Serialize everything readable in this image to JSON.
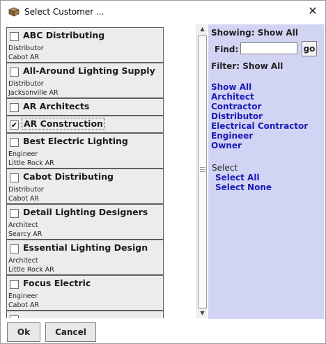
{
  "window": {
    "title": "Select Customer ...",
    "close_glyph": "✕"
  },
  "icons": {
    "app": "box-icon",
    "close": "close-icon"
  },
  "customers": [
    {
      "name": "ABC Distributing",
      "type": "Distributor",
      "location": "Cabot  AR",
      "checked": false
    },
    {
      "name": "All-Around Lighting Supply",
      "type": "Distributor",
      "location": "Jacksonville  AR",
      "checked": false
    },
    {
      "name": "AR Architects",
      "type": "",
      "location": "",
      "checked": false
    },
    {
      "name": "AR Construction",
      "type": "",
      "location": "",
      "checked": true
    },
    {
      "name": "Best Electric Lighting",
      "type": "Engineer",
      "location": "Little Rock  AR",
      "checked": false
    },
    {
      "name": "Cabot Distributing",
      "type": "Distributor",
      "location": "Cabot  AR",
      "checked": false
    },
    {
      "name": "Detail Lighting Designers",
      "type": "Architect",
      "location": "Searcy  AR",
      "checked": false
    },
    {
      "name": "Essential Lighting Design",
      "type": "Architect",
      "location": "Little Rock  AR",
      "checked": false
    },
    {
      "name": "Focus Electric",
      "type": "Engineer",
      "location": "Cabot  AR",
      "checked": false
    }
  ],
  "filter_panel": {
    "showing": "Showing: Show All",
    "find_label": "Find:",
    "find_value": "",
    "go_label": "go",
    "filter_label": "Filter: Show All",
    "filters": [
      "Show All",
      "Architect",
      "Contractor",
      "Distributor",
      "Electrical Contractor",
      "Engineer",
      "Owner"
    ],
    "select_label": "Select",
    "select_all": "Select All",
    "select_none": "Select None"
  },
  "buttons": {
    "ok": "Ok",
    "cancel": "Cancel"
  },
  "colors": {
    "filter_bg": "#d2d4f3",
    "link": "#1a1ab8",
    "item_bg": "#ececec"
  }
}
